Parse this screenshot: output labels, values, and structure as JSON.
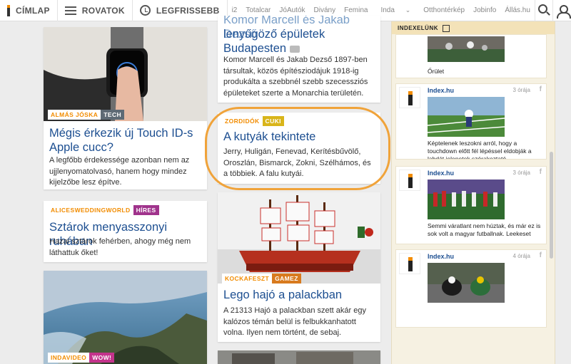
{
  "nav": {
    "cimlap": "CÍMLAP",
    "rovatok": "ROVATOK",
    "legfrissebb": "LEGFRISSEBB",
    "sites": [
      "i2",
      "Totalcar",
      "JóAutók",
      "Divány",
      "Femina",
      "Inda",
      "Otthontérkép",
      "Jobinfo",
      "Állás.hu"
    ]
  },
  "cards": {
    "watch": {
      "tag": "ALMÁS JÓSKA",
      "tag2": "TECH",
      "title": "Mégis érkezik új Touch ID-s Apple cucc?",
      "lead": "A legfőbb érdekessége azonban nem az ujjlenyomatolvasó, hanem hogy mindez kijelzőbe lesz építve."
    },
    "alice": {
      "tag": "ALICESWEDDINGWORLD",
      "tag2": "HÍRES",
      "title": "Sztárok menyasszonyi ruhában",
      "lead": "Hazai sztárok fehérben, ahogy még nem láthattuk őket!"
    },
    "indavideo": {
      "tag": "INDAVIDEO",
      "tag2": "WOW!"
    },
    "budapest": {
      "title_top": "Komor Marcell és Jakab Dezső",
      "title": "lenyűgöző épületek Budapesten",
      "lead": "Komor Marcell és Jakab Dezső 1897-ben társultak, közös építésziodájuk 1918-ig produkálta a szebbnél szebb szecessziós épületeket szerte a Monarchia területén."
    },
    "dogs": {
      "tag": "ZORDIDÓK",
      "tag2": "CUKI",
      "title": "A kutyák tekintete",
      "lead": "Jerry, Huligán, Fenevad, Kerítésbűvölő, Oroszlán, Bismarck, Zokni, Szélhámos, és a többiek. A falu kutyái."
    },
    "lego": {
      "tag": "KOCKAFESZT",
      "tag2": "GAMEZ",
      "title": "Lego hajó a palackban",
      "lead": "A 21313 Hajó a palackban szett akár egy kalózos témán belül is felbukkanhatott volna. Ilyen nem történt, de sebaj."
    }
  },
  "rail": {
    "header": "INDEXELÜNK",
    "first_caption": "Őrület",
    "items": [
      {
        "source": "Index.hu",
        "time": "3 órája",
        "caption": "Képtelenek leszokni arról, hogy a touchdown előtt fél lépéssel eldobják a labdát jelenetek szórakoztató"
      },
      {
        "source": "Index.hu",
        "time": "3 órája",
        "caption": "Semmi váratlant nem húztak, és már ez is sok volt a magyar futballnak. Leekeset pedig megnevettek"
      },
      {
        "source": "Index.hu",
        "time": "4 órája",
        "caption": ""
      }
    ]
  },
  "colors": {
    "link": "#1d4f91",
    "tech": "#5e6a75",
    "hires": "#a0338c",
    "cuki": "#d9b51a",
    "gamez": "#d87a1e",
    "wow": "#c4338c",
    "annotation": "#f0a33a"
  }
}
